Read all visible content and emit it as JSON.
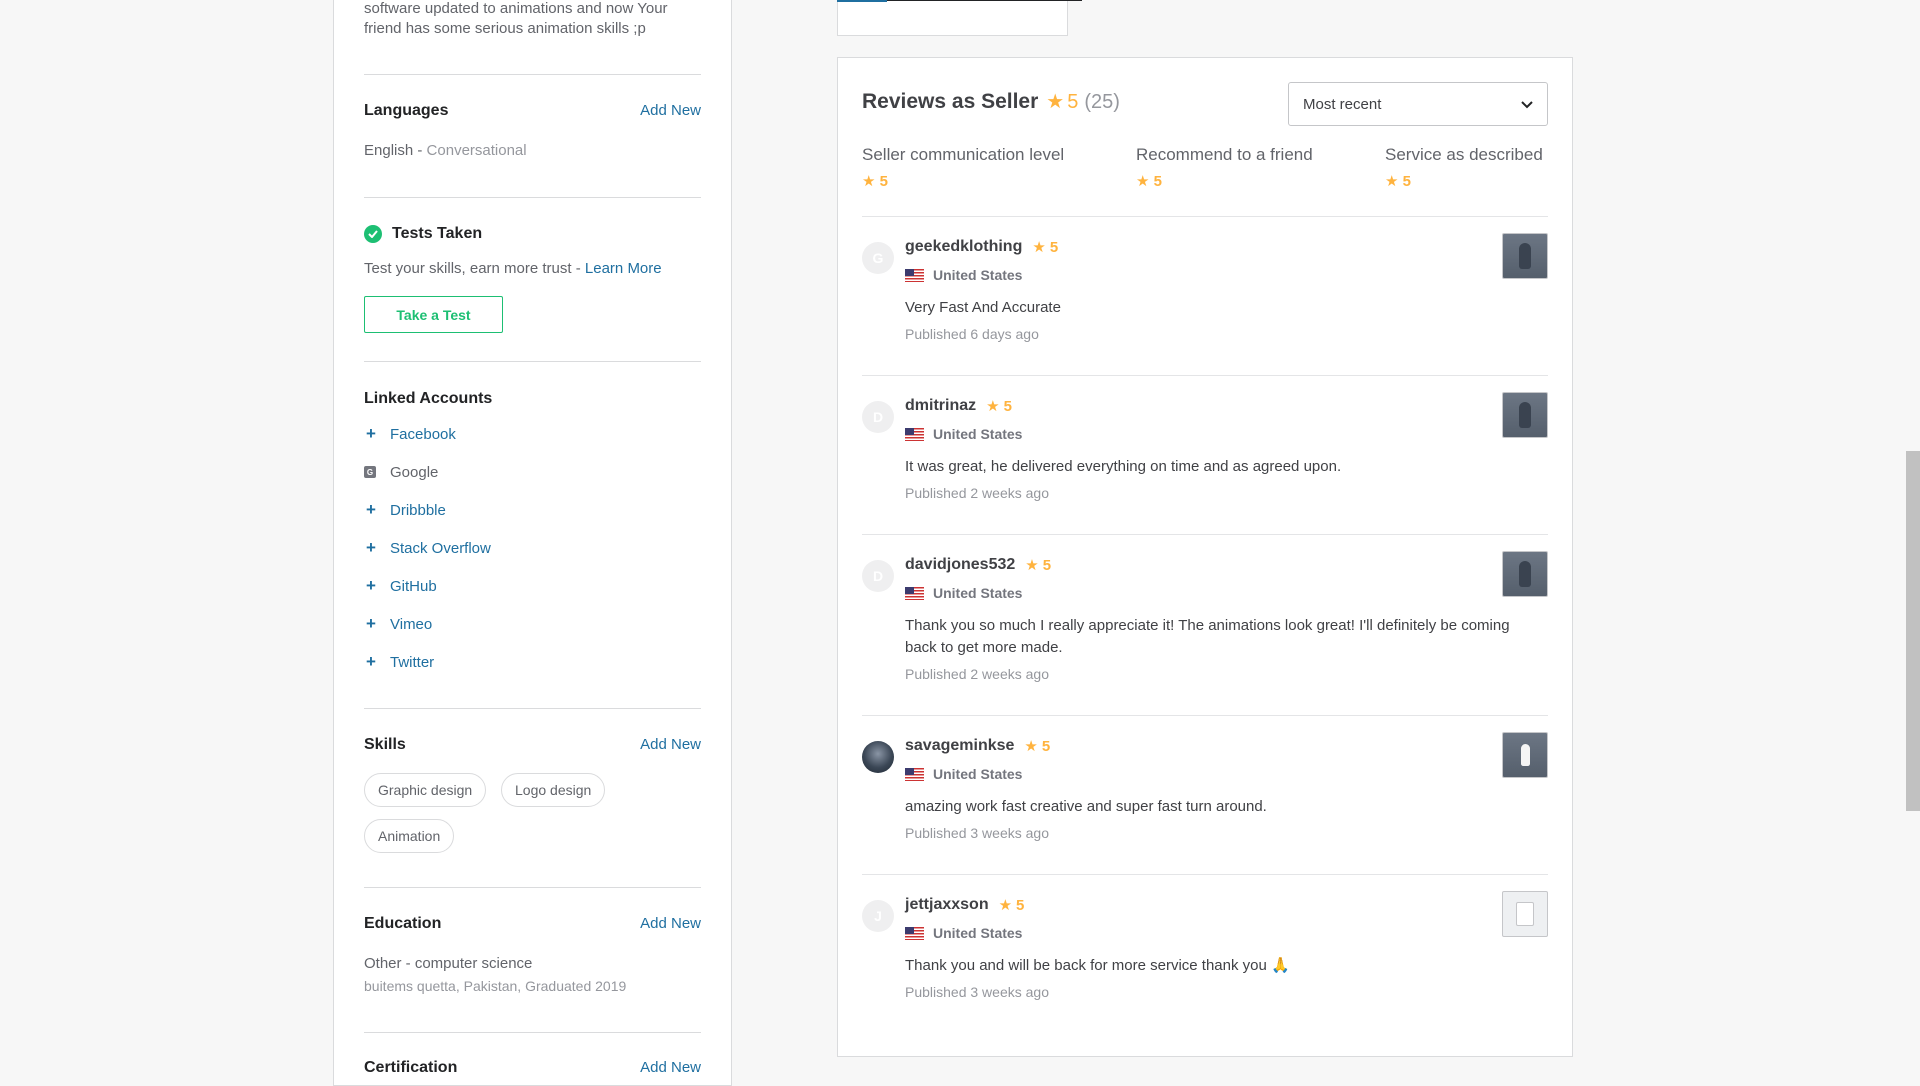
{
  "sidebar": {
    "intro_text_line1": "software updated to animations and now Your",
    "intro_text_line2": "friend has some serious animation skills ;p",
    "languages": {
      "title": "Languages",
      "add_label": "Add New",
      "language": "English",
      "separator": " - ",
      "level": "Conversational"
    },
    "tests": {
      "title": "Tests Taken",
      "desc": "Test your skills, earn more trust - ",
      "learn_more": "Learn More",
      "button": "Take a Test"
    },
    "linked_accounts": {
      "title": "Linked Accounts",
      "items": [
        {
          "label": "Facebook",
          "icon": "plus-icon"
        },
        {
          "label": "Google",
          "icon": "google-icon"
        },
        {
          "label": "Dribbble",
          "icon": "plus-icon"
        },
        {
          "label": "Stack Overflow",
          "icon": "plus-icon"
        },
        {
          "label": "GitHub",
          "icon": "plus-icon"
        },
        {
          "label": "Vimeo",
          "icon": "plus-icon"
        },
        {
          "label": "Twitter",
          "icon": "plus-icon"
        }
      ]
    },
    "skills": {
      "title": "Skills",
      "add_label": "Add New",
      "chips": [
        "Graphic design",
        "Logo design",
        "Animation"
      ]
    },
    "education": {
      "title": "Education",
      "add_label": "Add New",
      "degree": "Other - computer science",
      "details": "buitems quetta, Pakistan, Graduated 2019"
    },
    "certification": {
      "title": "Certification",
      "add_label": "Add New"
    }
  },
  "reviews": {
    "title": "Reviews as Seller",
    "rating": "5",
    "count": "(25)",
    "sort": {
      "selected": "Most recent"
    },
    "criteria": [
      {
        "label": "Seller communication level",
        "value": "5"
      },
      {
        "label": "Recommend to a friend",
        "value": "5"
      },
      {
        "label": "Service as described",
        "value": "5"
      }
    ],
    "items": [
      {
        "initial": "G",
        "user": "geekedklothing",
        "rating": "5",
        "country": "United States",
        "text": "Very Fast And Accurate",
        "date": "Published 6 days ago"
      },
      {
        "initial": "D",
        "user": "dmitrinaz",
        "rating": "5",
        "country": "United States",
        "text": "It was great, he delivered everything on time and as agreed upon.",
        "date": "Published 2 weeks ago"
      },
      {
        "initial": "D",
        "user": "davidjones532",
        "rating": "5",
        "country": "United States",
        "text_line1": "Thank you so much I really appreciate it! The animations look great! I'll definitely be coming",
        "text_line2": "back to get more made.",
        "date": "Published 2 weeks ago"
      },
      {
        "initial": "",
        "user": "savageminkse",
        "rating": "5",
        "country": "United States",
        "text": "amazing work fast creative and super fast turn around.",
        "date": "Published 3 weeks ago"
      },
      {
        "initial": "J",
        "user": "jettjaxxson",
        "rating": "5",
        "country": "United States",
        "text": "Thank you and will be back for more service thank you 🙏",
        "date": "Published 3 weeks ago"
      }
    ]
  },
  "colors": {
    "accent_green": "#1dbf73",
    "star": "#ffb33e",
    "link": "#1f6fa0"
  }
}
